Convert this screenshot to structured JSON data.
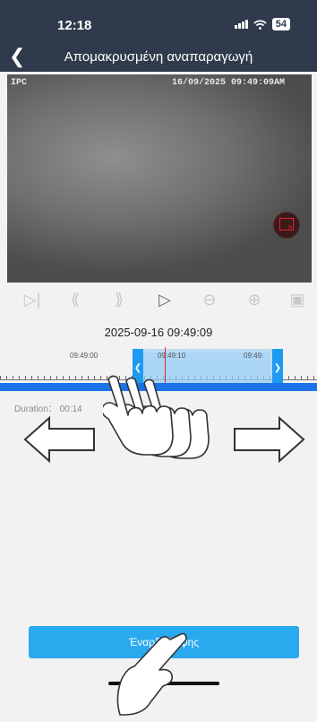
{
  "status_bar": {
    "time": "12:18",
    "battery": "54"
  },
  "nav": {
    "title": "Απομακρυσμένη αναπαραγωγή"
  },
  "video": {
    "osd_left": "IPC",
    "osd_right": "16/09/2025 09:49:09AM"
  },
  "playback": {
    "datetime": "2025-09-16 09:49:09"
  },
  "timeline": {
    "labels": [
      "09:49:00",
      "09:49:10",
      "09:49:"
    ]
  },
  "duration": "Duration： 00:14",
  "start_button": "Έναρξη λήψης",
  "colors": {
    "header": "#2f3b4c",
    "accent": "#29a9ee",
    "record_bar": "#1a73e8"
  },
  "icons": [
    "back-chevron-icon",
    "signal-icon",
    "wifi-icon",
    "battery-icon",
    "record-clip-icon",
    "skip-start-icon",
    "rewind-icon",
    "fast-forward-icon",
    "play-icon",
    "previous-icon",
    "next-icon",
    "screenshot-icon",
    "hand-swipe-icon",
    "hand-tap-icon",
    "arrow-left-icon",
    "arrow-right-icon"
  ]
}
